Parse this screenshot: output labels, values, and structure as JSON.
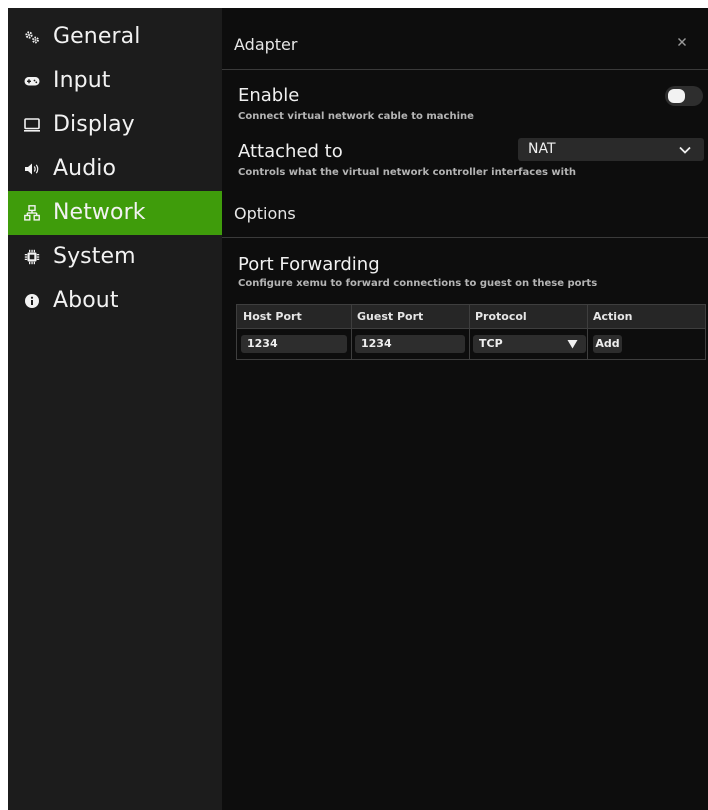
{
  "sidebar": {
    "items": [
      {
        "label": "General",
        "icon": "gears-icon",
        "active": false
      },
      {
        "label": "Input",
        "icon": "gamepad-icon",
        "active": false
      },
      {
        "label": "Display",
        "icon": "monitor-icon",
        "active": false
      },
      {
        "label": "Audio",
        "icon": "speaker-icon",
        "active": false
      },
      {
        "label": "Network",
        "icon": "network-icon",
        "active": true
      },
      {
        "label": "System",
        "icon": "chip-icon",
        "active": false
      },
      {
        "label": "About",
        "icon": "info-icon",
        "active": false
      }
    ]
  },
  "adapter": {
    "title": "Adapter",
    "close_icon": "close-icon",
    "enable": {
      "label": "Enable",
      "description": "Connect virtual network cable to machine",
      "checked": false
    },
    "attached_to": {
      "label": "Attached to",
      "description": "Controls what the virtual network controller interfaces with",
      "value": "NAT"
    }
  },
  "options": {
    "title": "Options",
    "port_forwarding": {
      "title": "Port Forwarding",
      "description": "Configure xemu to forward connections to guest on these ports",
      "columns": [
        "Host Port",
        "Guest Port",
        "Protocol",
        "Action"
      ],
      "row": {
        "host_port": "1234",
        "guest_port": "1234",
        "protocol": "TCP",
        "action": "Add"
      }
    }
  },
  "colors": {
    "accent": "#3f9c0b",
    "sidebar_bg": "#1c1c1c",
    "content_bg": "#0d0d0d"
  }
}
